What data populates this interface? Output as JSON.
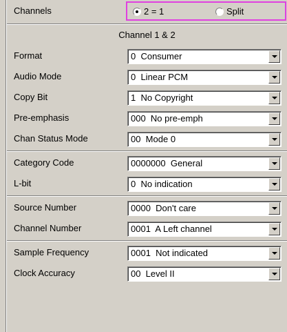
{
  "channels": {
    "label": "Channels",
    "options": [
      {
        "label": "2 = 1",
        "selected": true
      },
      {
        "label": "Split",
        "selected": false
      }
    ]
  },
  "section_title": "Channel 1 & 2",
  "fields": [
    {
      "label": "Format",
      "value": "0  Consumer"
    },
    {
      "label": "Audio Mode",
      "value": "0  Linear PCM"
    },
    {
      "label": "Copy Bit",
      "value": "1  No Copyright"
    },
    {
      "label": "Pre-emphasis",
      "value": "000  No pre-emph"
    },
    {
      "label": "Chan Status Mode",
      "value": "00  Mode 0"
    },
    {
      "label": "Category Code",
      "value": "0000000  General"
    },
    {
      "label": "L-bit",
      "value": "0  No indication"
    },
    {
      "label": "Source Number",
      "value": "0000  Don't care"
    },
    {
      "label": "Channel Number",
      "value": "0001  A Left channel"
    },
    {
      "label": "Sample Frequency",
      "value": "0001  Not indicated"
    },
    {
      "label": "Clock Accuracy",
      "value": "00  Level II"
    }
  ],
  "colors": {
    "background": "#d4d0c8",
    "focus_border": "#e040e0"
  }
}
